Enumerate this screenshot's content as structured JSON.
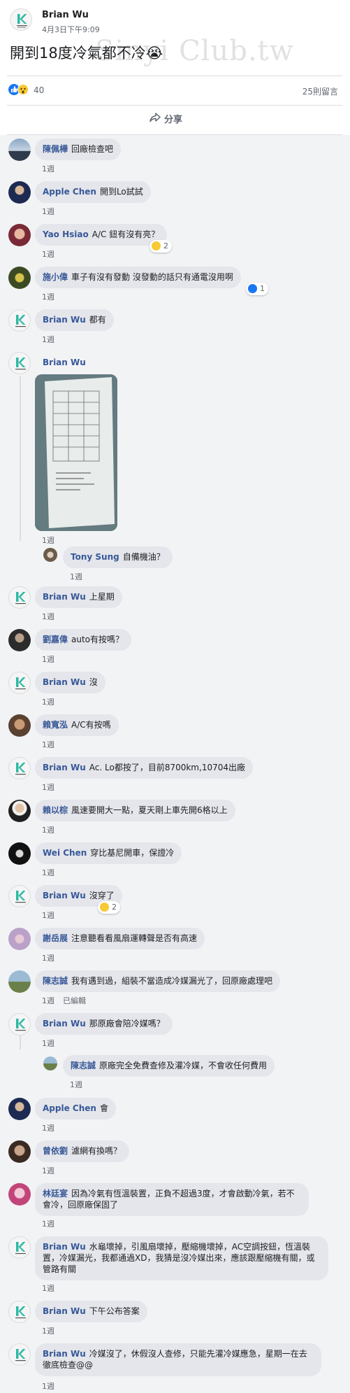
{
  "post": {
    "author": "Brian Wu",
    "time": "4月3日下午9:09",
    "text": "開到18度冷氣都不冷😭",
    "watermark": "Sinyi Club.tw",
    "reaction_count": "40",
    "comment_count": "25則留言",
    "share_label": "分享"
  },
  "comments": [
    {
      "name": "陳佩樺",
      "text": "回廠檢查吧",
      "time": "1週"
    },
    {
      "name": "Apple Chen",
      "text": "開到Lo試試",
      "time": "1週"
    },
    {
      "name": "Yao Hsiao",
      "text": "A/C 鈕有沒有亮？",
      "time": "1週",
      "reaction_count": "2"
    },
    {
      "name": "施小偉",
      "text": "車子有沒有發動 沒發動的話只有通電沒用啊",
      "time": "1週",
      "reaction_count": "1"
    },
    {
      "name": "Brian Wu",
      "text": "都有",
      "time": "1週"
    },
    {
      "name": "Brian Wu",
      "text": "",
      "time": "1週"
    },
    {
      "name": "Tony Sung",
      "text": "自備機油？",
      "time": "1週"
    },
    {
      "name": "Brian Wu",
      "text": "上星期",
      "time": "1週"
    },
    {
      "name": "劉嘉偉",
      "text": "auto有按嗎？",
      "time": "1週"
    },
    {
      "name": "Brian Wu",
      "text": "沒",
      "time": "1週"
    },
    {
      "name": "賴寬泓",
      "text": "A/C有按嗎",
      "time": "1週"
    },
    {
      "name": "Brian Wu",
      "text": "Ac. Lo都按了，目前8700km,10704出廠",
      "time": "1週"
    },
    {
      "name": "賴以棕",
      "text": "風速要開大一點，夏天剛上車先開6格以上",
      "time": "1週"
    },
    {
      "name": "Wei Chen",
      "text": "穿比基尼開車，保證冷",
      "time": "1週"
    },
    {
      "name": "Brian Wu",
      "text": "沒穿了",
      "time": "1週",
      "reaction_count": "2"
    },
    {
      "name": "謝岳展",
      "text": "注意聽看看風扇運轉聲是否有高速",
      "time": "1週"
    },
    {
      "name": "陳志誠",
      "text": "我有遇到過，組裝不當造成冷媒漏光了，回原廠處理吧",
      "time": "1週",
      "edited": "已編輯"
    },
    {
      "name": "Brian Wu",
      "text": "那原廠會陪冷媒嗎？",
      "time": "1週"
    },
    {
      "name": "陳志誠",
      "text": "原廠完全免費查修及灌冷媒，不會收任何費用",
      "time": "1週"
    },
    {
      "name": "Apple Chen",
      "text": "會",
      "time": "1週"
    },
    {
      "name": "曾依劉",
      "text": "濾網有換嗎？",
      "time": "1週"
    },
    {
      "name": "林廷宴",
      "text": "因為冷氣有恆溫裝置，正負不超過3度，才會啟動冷氣，若不會冷，回原廠保固了",
      "time": "1週"
    },
    {
      "name": "Brian Wu",
      "text": "水龜壞掉，引風扇壞掉，壓縮機壞掉，AC空調按鈕，恆溫裝置，冷媒漏光，我都通過XD，我猜是沒冷媒出來，應該跟壓縮機有關，或管路有關",
      "time": "1週"
    },
    {
      "name": "Brian Wu",
      "text": "下午公布答案",
      "time": "1週"
    },
    {
      "name": "Brian Wu",
      "text": "冷媒沒了，休假沒人查修，只能先灌冷媒應急，星期一在去徹底檢查@@",
      "time": "1週"
    }
  ],
  "colors": {
    "name_link": "#385898",
    "bubble_bg": "#e4e6eb",
    "comments_bg": "#f2f3f5",
    "like_blue": "#1877f2",
    "brand_teal": "#2fb8a4"
  },
  "icons": {
    "logo": "k-brand-logo-icon",
    "share": "share-arrow-icon",
    "like": "like-reaction-icon",
    "wow": "wow-reaction-icon",
    "haha": "haha-reaction-icon"
  }
}
